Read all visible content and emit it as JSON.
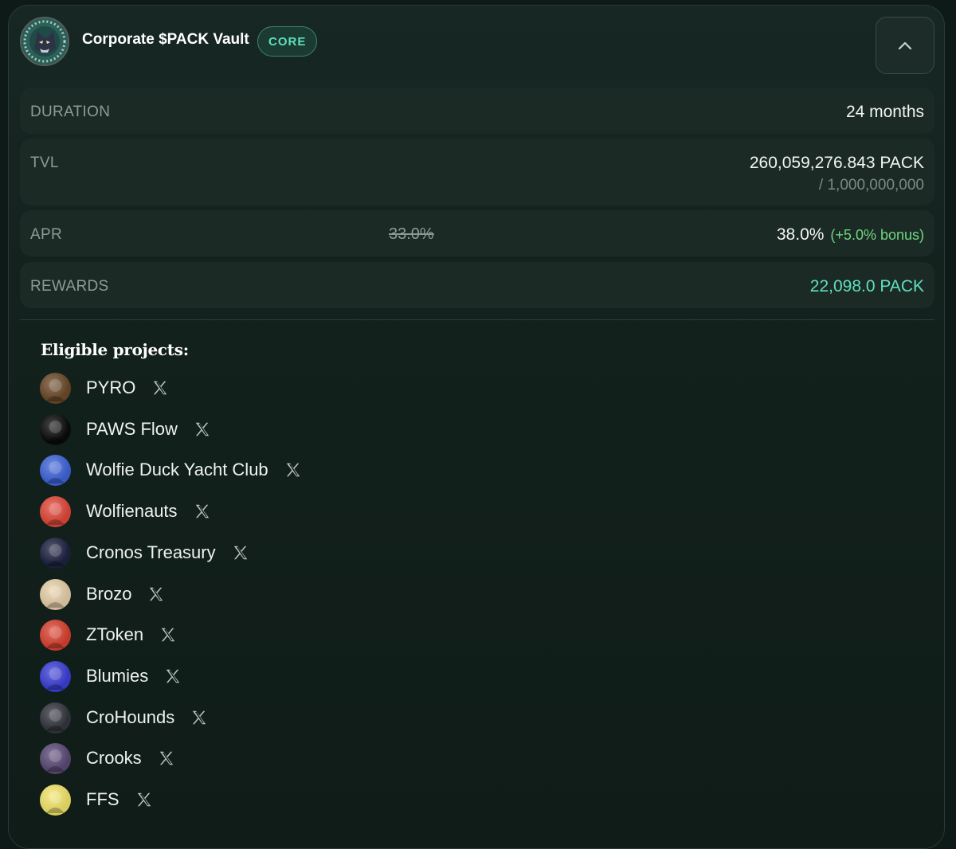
{
  "vault": {
    "title": "Corporate $PACK Vault",
    "badge": "CORE"
  },
  "stats": {
    "duration": {
      "label": "DURATION",
      "value": "24 months"
    },
    "tvl": {
      "label": "TVL",
      "value": "260,059,276.843 PACK",
      "cap": "/ 1,000,000,000"
    },
    "apr": {
      "label": "APR",
      "old_value": "33.0%",
      "value": "38.0%",
      "bonus": "(+5.0% bonus)"
    },
    "rewards": {
      "label": "REWARDS",
      "value": "22,098.0 PACK"
    }
  },
  "eligible": {
    "title": "Eligible projects:",
    "projects": [
      {
        "name": "PYRO",
        "icon": "pyro-avatar-icon",
        "color": "#6b4a2a"
      },
      {
        "name": "PAWS Flow",
        "icon": "paws-flow-avatar-icon",
        "color": "#0b0b0b"
      },
      {
        "name": "Wolfie Duck Yacht Club",
        "icon": "wolfie-duck-avatar-icon",
        "color": "#3f64d9"
      },
      {
        "name": "Wolfienauts",
        "icon": "wolfienauts-avatar-icon",
        "color": "#e0483a"
      },
      {
        "name": "Cronos Treasury",
        "icon": "cronos-treasury-avatar-icon",
        "color": "#1d2240"
      },
      {
        "name": "Brozo",
        "icon": "brozo-avatar-icon",
        "color": "#e6cfa8"
      },
      {
        "name": "ZToken",
        "icon": "ztoken-avatar-icon",
        "color": "#d9412f"
      },
      {
        "name": "Blumies",
        "icon": "blumies-avatar-icon",
        "color": "#3b3fd6"
      },
      {
        "name": "CroHounds",
        "icon": "crohounds-avatar-icon",
        "color": "#33353d"
      },
      {
        "name": "Crooks",
        "icon": "crooks-avatar-icon",
        "color": "#5b4a76"
      },
      {
        "name": "FFS",
        "icon": "ffs-avatar-icon",
        "color": "#f2e46a"
      }
    ]
  },
  "colors": {
    "accent": "#5fe0bd",
    "bonus": "#6ed680",
    "background": "#0e1a17",
    "row": "#1c2a26"
  }
}
